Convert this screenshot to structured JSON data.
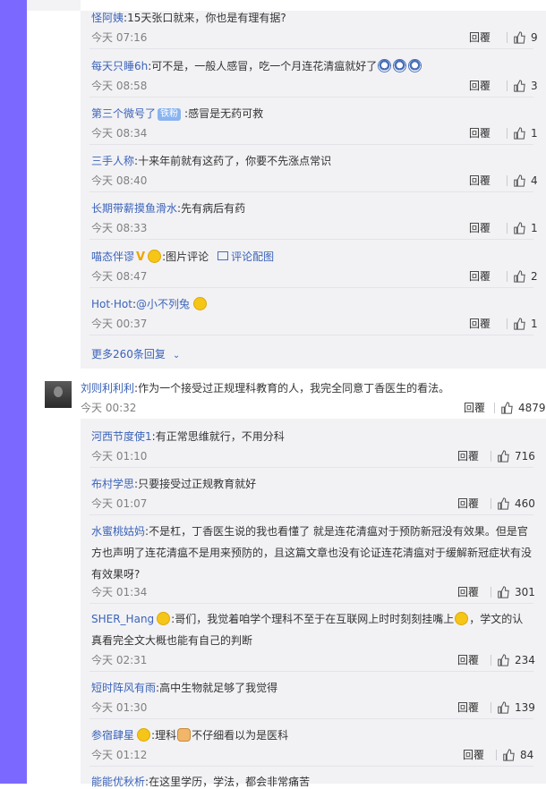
{
  "reply_label": "回覆",
  "more_replies_label": "更多260条回复",
  "sub_replies_top": [
    {
      "name": "怪阿姨",
      "sep": ":",
      "text": "15天张口就来，你也是有理有据?",
      "time": "今天 07:16",
      "likes": "9"
    },
    {
      "name": "每天只睡6h",
      "sep": ":",
      "text": "可不是，一般人感冒，吃一个月连花清瘟就好了",
      "time": "今天 08:58",
      "likes": "3",
      "emojis": [
        "blue-face-icon",
        "blue-face-icon",
        "blue-face-icon"
      ]
    },
    {
      "name": "第三个微号了",
      "badge": "铁粉",
      "sep": ":",
      "text": "感冒是无药可救",
      "time": "今天 08:34",
      "likes": "1"
    },
    {
      "name": "三手人称",
      "sep": ":",
      "text": "十来年前就有这药了，你要不先涨点常识",
      "time": "今天 08:40",
      "likes": "4"
    },
    {
      "name": "长期带薪摸鱼滑水",
      "sep": ":",
      "text": "先有病后有药",
      "time": "今天 08:33",
      "likes": "1"
    },
    {
      "name": "喵态伴谬",
      "sep": ":",
      "text": "图片评论",
      "link": "评论配图",
      "time": "今天 08:47",
      "likes": "2"
    },
    {
      "name": "Hot·Hot",
      "sep": ":",
      "text": "@小不列兔",
      "time": "今天 00:37",
      "likes": "1"
    }
  ],
  "main_comment": {
    "name": "刘则利利利",
    "sep": ":",
    "text": "作为一个接受过正规理科教育的人，我完全同意丁香医生的看法。",
    "time": "今天 00:32",
    "likes": "4879"
  },
  "sub_replies_bottom": [
    {
      "name": "河西节度使1",
      "sep": ":",
      "text": "有正常思维就行，不用分科",
      "time": "今天 01:10",
      "likes": "716"
    },
    {
      "name": "布村学思",
      "sep": ":",
      "text": "只要接受过正规教育就好",
      "time": "今天 01:07",
      "likes": "460"
    },
    {
      "name": "水蜜桃姑妈",
      "sep": ":",
      "text_lines": [
        "不是杠，丁香医生说的我也看懂了 就是连花清瘟对于预防新冠没有效果。但是官",
        "方也声明了连花清瘟不是用来预防的，且这篇文章也没有论证连花清瘟对于缓解新冠症状有没",
        "有效果呀?"
      ],
      "time": "今天 01:34",
      "likes": "301"
    },
    {
      "name": "SHER_Hang",
      "sep": ":",
      "text_lines": [
        "哥们，我觉着咱学个理科不至于在互联网上时时刻刻挂嘴上",
        "，学文的认",
        "真看完全文大概也能有自己的判断"
      ],
      "time": "今天 02:31",
      "likes": "234"
    },
    {
      "name": "短时阵风有雨",
      "sep": ":",
      "text": "高中生物就足够了我觉得",
      "time": "今天 01:30",
      "likes": "139"
    },
    {
      "name": "参宿肆星",
      "sep": ":",
      "text": "理科",
      "text2": "不仔细看以为是医科",
      "time": "今天 01:12",
      "likes": "84"
    },
    {
      "name": "能能优秋析",
      "sep": ":",
      "text": "在这里学历，学法，都会非常痛苦"
    }
  ]
}
